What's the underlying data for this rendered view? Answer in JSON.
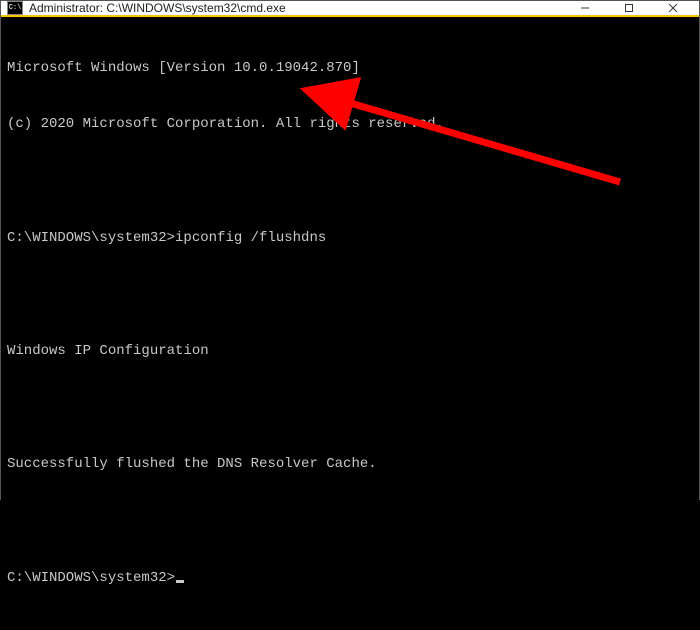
{
  "titlebar": {
    "icon_label": "C:\\",
    "title": "Administrator: C:\\WINDOWS\\system32\\cmd.exe",
    "minimize_label": "Minimize",
    "maximize_label": "Maximize",
    "close_label": "Close"
  },
  "terminal": {
    "version_line": "Microsoft Windows [Version 10.0.19042.870]",
    "copyright_line": "(c) 2020 Microsoft Corporation. All rights reserved.",
    "prompt1": "C:\\WINDOWS\\system32>",
    "command1": "ipconfig /flushdns",
    "response_header": "Windows IP Configuration",
    "response_body": "Successfully flushed the DNS Resolver Cache.",
    "prompt2": "C:\\WINDOWS\\system32>"
  },
  "annotation": {
    "arrow_color": "#ff0000"
  }
}
